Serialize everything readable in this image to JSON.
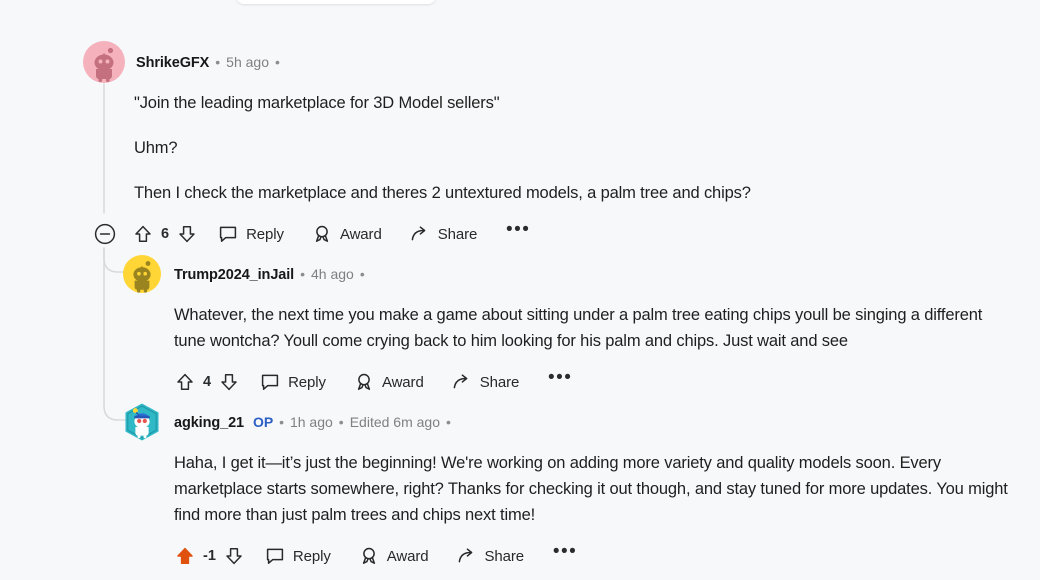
{
  "page": {
    "background_color": "#f7f8fa",
    "text_color": "#1f1f1f",
    "meta_color": "#7e8083",
    "op_color": "#2b5fc4",
    "upvote_active_color": "#e0510d"
  },
  "labels": {
    "reply": "Reply",
    "award": "Award",
    "share": "Share",
    "more": "•••",
    "op": "OP",
    "separator": "•"
  },
  "comments": [
    {
      "id": "c0",
      "depth": 0,
      "author": "ShrikeGFX",
      "is_op": false,
      "timestamp": "5h ago",
      "edited": "",
      "avatar": {
        "name": "avatar-shrikegfx",
        "style": "snoo-circle",
        "bg": "#f5b2bd",
        "fg": "#c4707f"
      },
      "score": "6",
      "voted": "none",
      "collapsible": true,
      "paragraphs": [
        "\"Join the leading marketplace for 3D Model sellers\"",
        "Uhm?",
        "Then I check the marketplace and theres 2 untextured models, a palm tree and chips?"
      ]
    },
    {
      "id": "c1",
      "depth": 1,
      "author": "Trump2024_inJail",
      "is_op": false,
      "timestamp": "4h ago",
      "edited": "",
      "avatar": {
        "name": "avatar-trump2024-injail",
        "style": "snoo-circle",
        "bg": "#ffd635",
        "fg": "#9a8420"
      },
      "score": "4",
      "voted": "none",
      "collapsible": false,
      "paragraphs": [
        "Whatever, the next time you make a game about sitting under a palm tree eating chips youll be singing a different tune wontcha? Youll come crying back to him looking for his palm and chips. Just wait and see"
      ]
    },
    {
      "id": "c2",
      "depth": 2,
      "author": "agking_21",
      "is_op": true,
      "timestamp": "1h ago",
      "edited": "Edited 6m ago",
      "avatar": {
        "name": "avatar-agking-21",
        "style": "snoo-hex",
        "bg": "#2fb8c6",
        "fg": "#ffffff",
        "hat": "#2b6bd6",
        "pom": "#ffd635"
      },
      "score": "-1",
      "voted": "up",
      "collapsible": false,
      "paragraphs": [
        "Haha, I get it—it’s just the beginning! We're working on adding more variety and quality models soon. Every marketplace starts somewhere, right? Thanks for checking it out though, and stay tuned for more updates. You might find more than just palm trees and chips next time!"
      ]
    }
  ]
}
